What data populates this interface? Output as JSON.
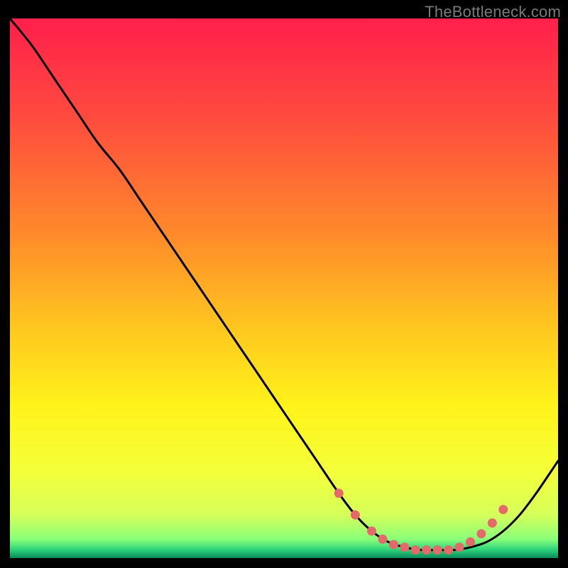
{
  "attribution": "TheBottleneck.com",
  "chart_data": {
    "type": "line",
    "title": "",
    "xlabel": "",
    "ylabel": "",
    "xlim": [
      0,
      100
    ],
    "ylim": [
      0,
      100
    ],
    "series": [
      {
        "name": "bottleneck-curve",
        "x": [
          0,
          4,
          8,
          12,
          16,
          20,
          24,
          28,
          32,
          36,
          40,
          44,
          48,
          52,
          56,
          60,
          63,
          66,
          69,
          72,
          75,
          78,
          81,
          84,
          87,
          90,
          93,
          96,
          100
        ],
        "y": [
          100,
          95,
          89,
          83,
          77,
          72,
          66,
          60,
          54,
          48,
          42,
          36,
          30,
          24,
          18,
          12,
          8,
          5,
          3,
          2,
          1.5,
          1.5,
          1.5,
          2,
          3,
          5,
          8,
          12,
          18
        ]
      }
    ],
    "markers": {
      "name": "valley-dots",
      "x": [
        60,
        63,
        66,
        68,
        70,
        72,
        74,
        76,
        78,
        80,
        82,
        84,
        86,
        88,
        90
      ],
      "y": [
        12,
        8,
        5,
        3.5,
        2.5,
        2,
        1.5,
        1.5,
        1.5,
        1.5,
        2,
        3,
        4.5,
        6.5,
        9
      ]
    },
    "gradient_stops": [
      {
        "offset": 0.0,
        "color": "#ff1f4b"
      },
      {
        "offset": 0.18,
        "color": "#ff4a3f"
      },
      {
        "offset": 0.4,
        "color": "#ff8a2a"
      },
      {
        "offset": 0.58,
        "color": "#ffc91f"
      },
      {
        "offset": 0.72,
        "color": "#fff31a"
      },
      {
        "offset": 0.84,
        "color": "#f4ff3a"
      },
      {
        "offset": 0.92,
        "color": "#d6ff5a"
      },
      {
        "offset": 0.965,
        "color": "#8aff7a"
      },
      {
        "offset": 0.985,
        "color": "#2bd27a"
      },
      {
        "offset": 1.0,
        "color": "#0a8a5a"
      }
    ]
  }
}
